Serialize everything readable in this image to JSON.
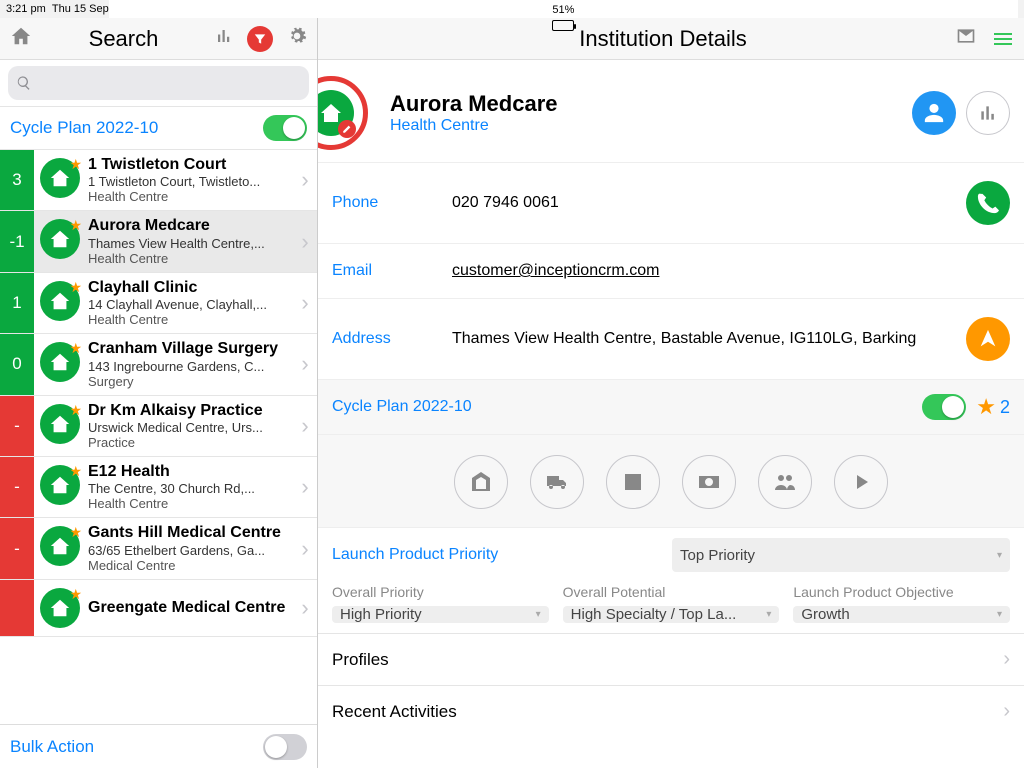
{
  "status": {
    "time": "3:21 pm",
    "date": "Thu 15 Sep",
    "battery": "51%"
  },
  "left_header": {
    "title": "Search"
  },
  "search": {
    "placeholder": ""
  },
  "cycle_plan": {
    "label": "Cycle Plan 2022-10",
    "on": true
  },
  "list": [
    {
      "badge": "3",
      "badge_color": "green",
      "name": "1 Twistleton Court",
      "sub": "1 Twistleton Court,  Twistleto...",
      "type": "Health Centre",
      "starred": true
    },
    {
      "badge": "-1",
      "badge_color": "green",
      "name": "Aurora Medcare",
      "sub": "Thames View Health Centre,...",
      "type": "Health Centre",
      "starred": true,
      "selected": true
    },
    {
      "badge": "1",
      "badge_color": "green",
      "name": "Clayhall Clinic",
      "sub": "14 Clayhall Avenue,  Clayhall,...",
      "type": "Health Centre",
      "starred": true
    },
    {
      "badge": "0",
      "badge_color": "green",
      "name": "Cranham Village Surgery",
      "sub": "143 Ingrebourne Gardens,  C...",
      "type": "Surgery",
      "starred": true
    },
    {
      "badge": "-",
      "badge_color": "red",
      "name": "Dr Km Alkaisy Practice",
      "sub": "Urswick Medical Centre,  Urs...",
      "type": "Practice",
      "starred": true
    },
    {
      "badge": "-",
      "badge_color": "red",
      "name": "E12 Health",
      "sub": "The Centre,  30 Church Rd,...",
      "type": "Health Centre",
      "starred": true
    },
    {
      "badge": "-",
      "badge_color": "red",
      "name": "Gants Hill Medical Centre",
      "sub": "63/65 Ethelbert Gardens,  Ga...",
      "type": "Medical Centre",
      "starred": true
    },
    {
      "badge": "",
      "badge_color": "red",
      "name": "Greengate Medical Centre",
      "sub": "",
      "type": "",
      "starred": true
    }
  ],
  "bulk_action": {
    "label": "Bulk Action"
  },
  "right_header": {
    "title": "Institution Details"
  },
  "institution": {
    "name": "Aurora Medcare",
    "type": "Health Centre",
    "phone_label": "Phone",
    "phone": "020 7946 0061",
    "email_label": "Email",
    "email": "customer@inceptioncrm.com",
    "address_label": "Address",
    "address": "Thames View Health Centre,  Bastable Avenue, IG110LG, Barking"
  },
  "detail_cycle_plan": {
    "label": "Cycle Plan 2022-10",
    "count": "2"
  },
  "launch_product_priority": {
    "label": "Launch Product Priority",
    "value": "Top Priority"
  },
  "overall_priority": {
    "label": "Overall Priority",
    "value": "High Priority"
  },
  "overall_potential": {
    "label": "Overall Potential",
    "value": "High Specialty / Top La..."
  },
  "launch_objective": {
    "label": "Launch Product Objective",
    "value": "Growth"
  },
  "profiles_label": "Profiles",
  "recent_activities_label": "Recent Activities"
}
